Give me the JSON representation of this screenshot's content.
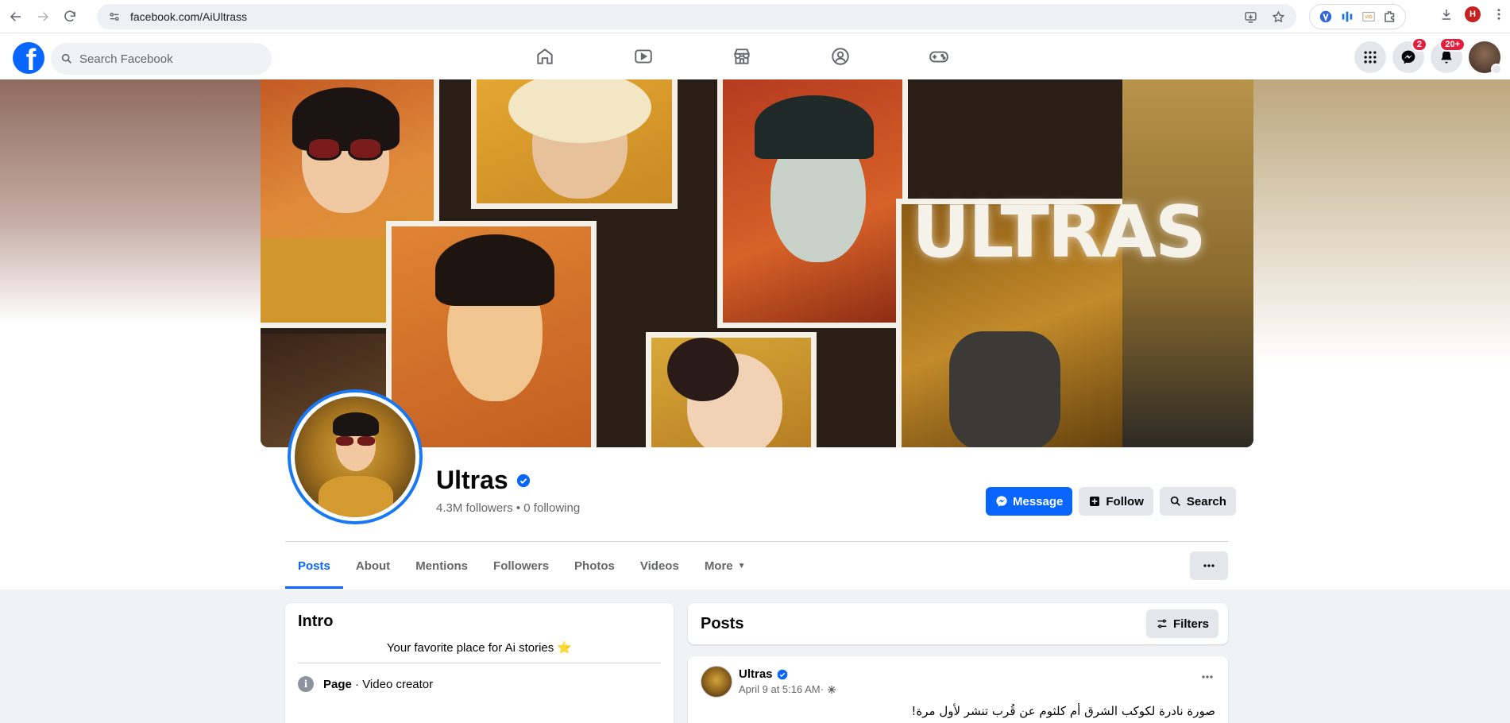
{
  "browser": {
    "url": "facebook.com/AiUltrass",
    "profile_initial": "H"
  },
  "header": {
    "search_placeholder": "Search Facebook",
    "messenger_badge": "2",
    "notifications_badge": "20+"
  },
  "cover": {
    "word": "ULTRAS"
  },
  "profile": {
    "name": "Ultras",
    "followers": "4.3M followers",
    "separator": " • ",
    "following": "0 following",
    "buttons": {
      "message": "Message",
      "follow": "Follow",
      "search": "Search"
    }
  },
  "tabs": [
    {
      "label": "Posts",
      "active": true
    },
    {
      "label": "About"
    },
    {
      "label": "Mentions"
    },
    {
      "label": "Followers"
    },
    {
      "label": "Photos"
    },
    {
      "label": "Videos"
    },
    {
      "label": "More"
    }
  ],
  "intro": {
    "title": "Intro",
    "bio": "Your favorite place for Ai stories ⭐",
    "category_label": "Page",
    "category_value": " · Video creator"
  },
  "posts_section": {
    "title": "Posts",
    "filters_label": "Filters"
  },
  "post": {
    "author": "Ultras",
    "time": "April 9 at 5:16 AM",
    "meta_sep": " · ",
    "text": "صورة نادرة لكوكب الشرق أم كلثوم عن قُرب تنشر لأول مرة!"
  },
  "colors": {
    "brand": "#0866ff",
    "background": "#f0f2f5",
    "secondary_text": "#65676b",
    "badge": "#e41e3f"
  }
}
